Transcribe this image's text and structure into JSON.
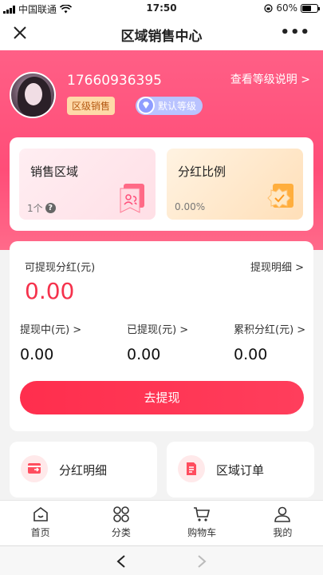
{
  "status_bar": {
    "carrier": "中国联通",
    "time": "17:50",
    "battery": "60%",
    "battery_level": 0.6
  },
  "nav": {
    "title": "区域销售中心",
    "more": "•••"
  },
  "profile": {
    "phone": "17660936395",
    "level_link": "查看等级说明 >",
    "badge_role": "区级销售",
    "badge_level": "默认等级"
  },
  "stats": [
    {
      "title": "销售区域",
      "value": "1个",
      "icon": "users-icon"
    },
    {
      "title": "分红比例",
      "value": "0.00%",
      "icon": "check-shield-icon"
    }
  ],
  "withdraw": {
    "label": "可提现分红(元)",
    "detail_link": "提现明细 >",
    "amount": "0.00",
    "columns": [
      {
        "label": "提现中(元) >",
        "value": "0.00"
      },
      {
        "label": "已提现(元) >",
        "value": "0.00"
      },
      {
        "label": "累积分红(元) >",
        "value": "0.00"
      }
    ],
    "button": "去提现"
  },
  "entries": [
    {
      "label": "分红明细",
      "icon": "bonus-detail-icon"
    },
    {
      "label": "区域订单",
      "icon": "order-icon"
    }
  ],
  "tabs": [
    {
      "label": "首页",
      "icon": "home-icon"
    },
    {
      "label": "分类",
      "icon": "category-icon"
    },
    {
      "label": "购物车",
      "icon": "cart-icon"
    },
    {
      "label": "我的",
      "icon": "profile-icon"
    }
  ],
  "colors": {
    "accent": "#ff4d78",
    "amount_red": "#f5324c",
    "button_red": "#ff2e4d"
  }
}
